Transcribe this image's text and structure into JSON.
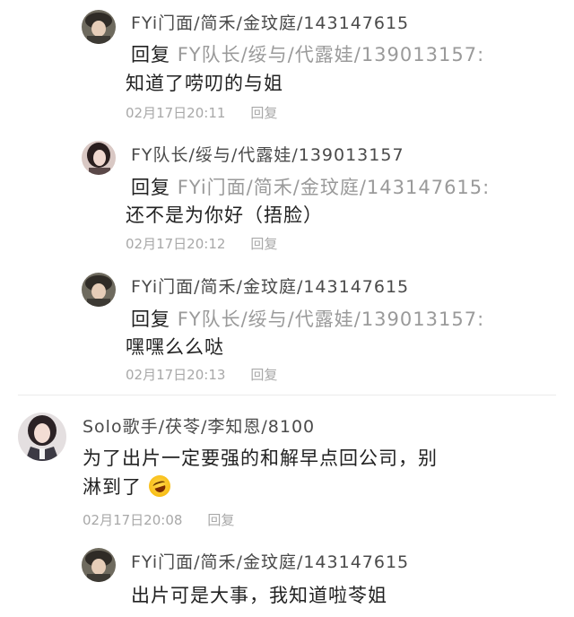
{
  "comments": [
    {
      "username": "FYi门面/简禾/金玟庭/143147615",
      "reply_prefix": "回复",
      "reply_to": "FY队长/绥与/代露娃/139013157:",
      "text": "知道了唠叨的与姐",
      "time": "02月17日20:11",
      "reply_label": "回复",
      "avatar": "dark-hair-hat-avatar"
    },
    {
      "username": "FY队长/绥与/代露娃/139013157",
      "reply_prefix": "回复",
      "reply_to": "FYi门面/简禾/金玟庭/143147615:",
      "text": "还不是为你好（捂脸）",
      "time": "02月17日20:12",
      "reply_label": "回复",
      "avatar": "girl-portrait-avatar"
    },
    {
      "username": "FYi门面/简禾/金玟庭/143147615",
      "reply_prefix": "回复",
      "reply_to": "FY队长/绥与/代露娃/139013157:",
      "text": "嘿嘿么么哒",
      "time": "02月17日20:13",
      "reply_label": "回复",
      "avatar": "dark-hair-hat-avatar"
    }
  ],
  "main_comment": {
    "username": "Solo歌手/茯苓/李知恩/8100",
    "text_line1": "为了出片一定要强的和解早点回公司，别",
    "text_line2": "淋到了",
    "emoji": "rolling-laughing-emoji",
    "time": "02月17日20:08",
    "reply_label": "回复",
    "avatar": "girl-blazer-avatar"
  },
  "last_reply": {
    "username": "FYi门面/简禾/金玟庭/143147615",
    "text": "出片可是大事，我知道啦苓姐",
    "avatar": "dark-hair-hat-avatar"
  }
}
